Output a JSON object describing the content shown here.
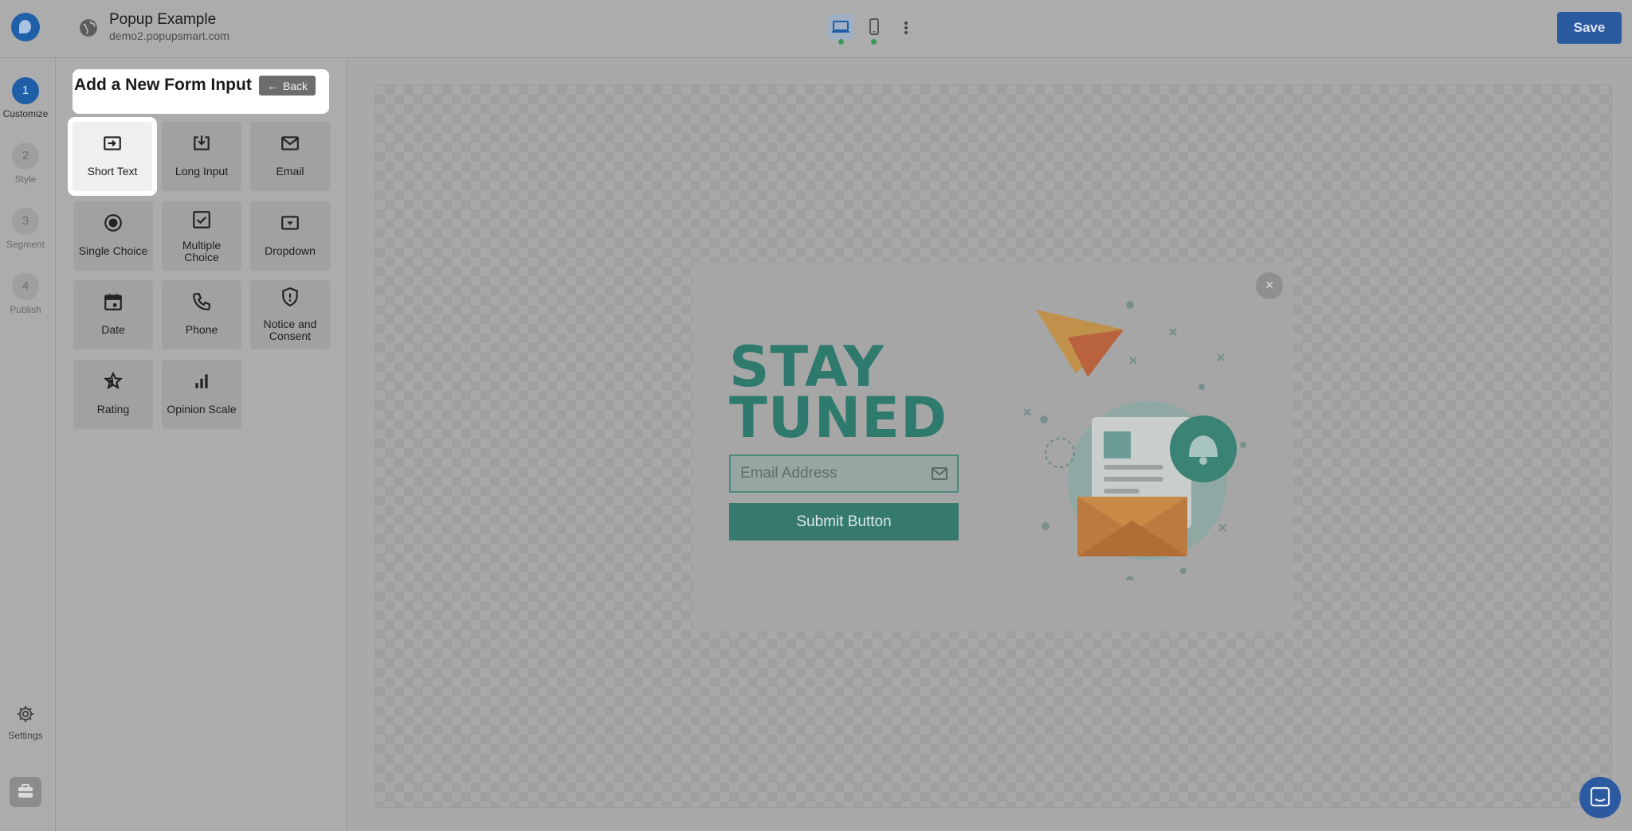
{
  "header": {
    "title": "Popup Example",
    "url": "demo2.popupsmart.com",
    "save_label": "Save"
  },
  "steps": [
    {
      "number": "1",
      "label": "Customize",
      "active": true
    },
    {
      "number": "2",
      "label": "Style",
      "active": false
    },
    {
      "number": "3",
      "label": "Segment",
      "active": false
    },
    {
      "number": "4",
      "label": "Publish",
      "active": false
    }
  ],
  "rail": {
    "settings_label": "Settings"
  },
  "panel": {
    "title": "Add a New Form Input",
    "back_label": "Back",
    "tiles": [
      {
        "label": "Short Text",
        "icon": "short-text-icon"
      },
      {
        "label": "Long Input",
        "icon": "long-input-icon"
      },
      {
        "label": "Email",
        "icon": "email-icon"
      },
      {
        "label": "Single Choice",
        "icon": "radio-icon"
      },
      {
        "label": "Multiple Choice",
        "icon": "checkbox-icon"
      },
      {
        "label": "Dropdown",
        "icon": "dropdown-icon"
      },
      {
        "label": "Date",
        "icon": "calendar-icon"
      },
      {
        "label": "Phone",
        "icon": "phone-icon"
      },
      {
        "label": "Notice and Consent",
        "icon": "shield-icon"
      },
      {
        "label": "Rating",
        "icon": "star-icon"
      },
      {
        "label": "Opinion Scale",
        "icon": "bar-chart-icon"
      }
    ]
  },
  "popup": {
    "headline_line1": "STAY",
    "headline_line2": "TUNED",
    "email_placeholder": "Email Address",
    "submit_label": "Submit Button",
    "close_label": "×"
  },
  "colors": {
    "brand": "#1f5fa8",
    "headline": "#2e7a6c",
    "submit": "#357a6d"
  }
}
